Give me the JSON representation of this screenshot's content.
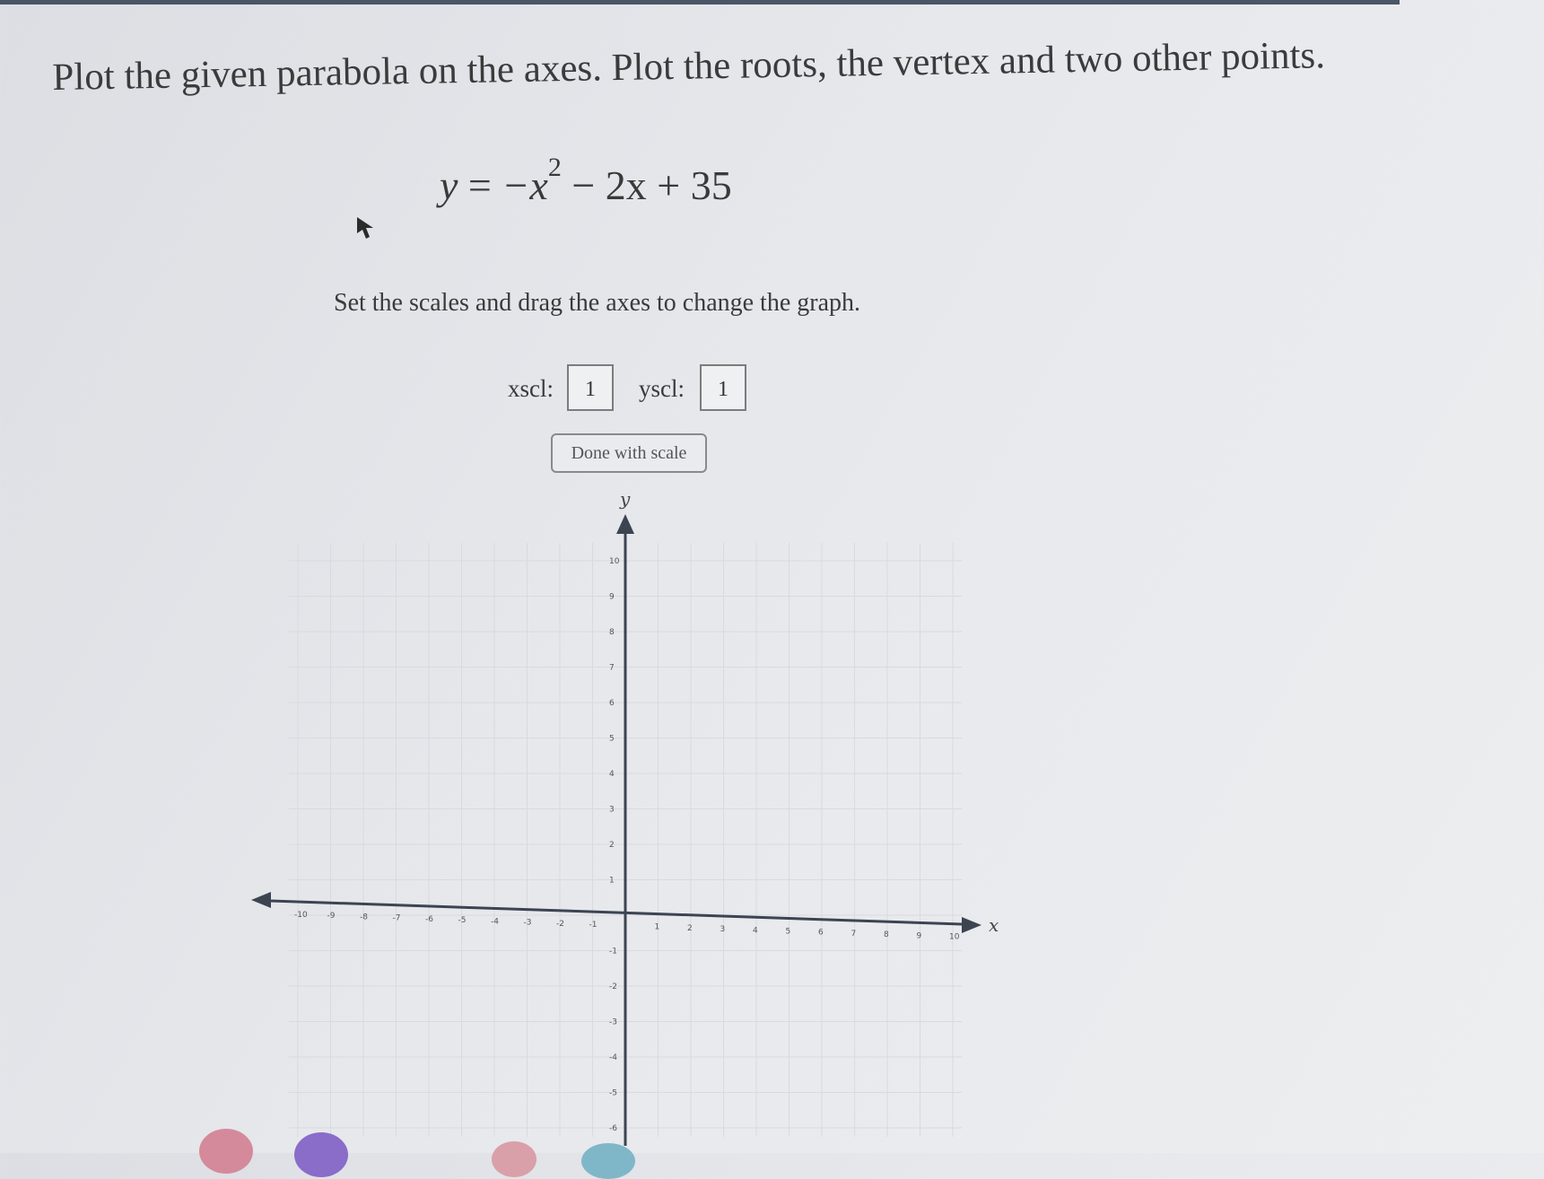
{
  "question": {
    "title": "Plot the given parabola on the axes. Plot the roots, the vertex and two other points.",
    "equation": {
      "y": "y",
      "equals": "=",
      "neg_x": "−x",
      "power": "2",
      "rest": "− 2x + 35"
    },
    "instructions": "Set the scales and drag the axes to change the graph."
  },
  "scales": {
    "xscl_label": "xscl:",
    "xscl_value": "1",
    "yscl_label": "yscl:",
    "yscl_value": "1",
    "done_button_label": "Done with scale"
  },
  "icons": {
    "cursor": "mouse-pointer-icon",
    "x_arrow": "arrow-right-icon",
    "x_arrow_left": "arrow-left-icon",
    "y_arrow": "arrow-up-icon"
  },
  "chart_data": {
    "type": "scatter",
    "xlabel": "x",
    "ylabel": "y",
    "xlim": [
      -10,
      10
    ],
    "ylim": [
      -6,
      10
    ],
    "x_ticks": [
      -10,
      -9,
      -8,
      -7,
      -6,
      -5,
      -4,
      -3,
      -2,
      -1,
      1,
      2,
      3,
      4,
      5,
      6,
      7,
      8,
      9,
      10
    ],
    "y_ticks": [
      10,
      9,
      8,
      7,
      6,
      5,
      4,
      3,
      2,
      1,
      -1,
      -2,
      -3,
      -4,
      -5,
      -6
    ],
    "grid": true,
    "series": []
  },
  "colors": {
    "axis": "#3c4452",
    "grid": "#d7dadf",
    "background": "#e4e6ea"
  }
}
